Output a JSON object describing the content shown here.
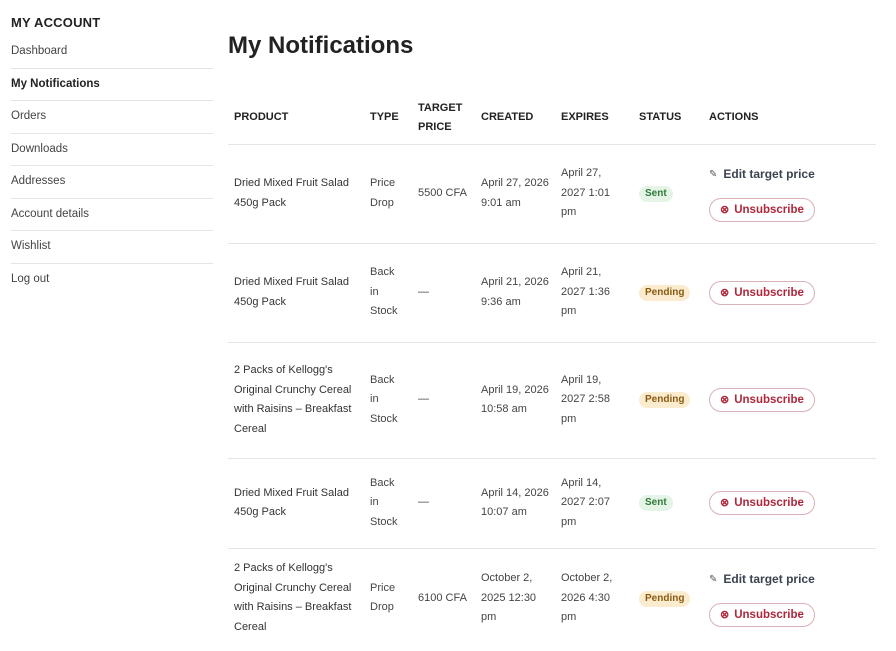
{
  "sidebar": {
    "title": "MY ACCOUNT",
    "items": [
      {
        "label": "Dashboard"
      },
      {
        "label": "My Notifications"
      },
      {
        "label": "Orders"
      },
      {
        "label": "Downloads"
      },
      {
        "label": "Addresses"
      },
      {
        "label": "Account details"
      },
      {
        "label": "Wishlist"
      },
      {
        "label": "Log out"
      }
    ]
  },
  "main": {
    "title": "My Notifications",
    "table": {
      "headers": {
        "product": "PRODUCT",
        "type": "TYPE",
        "target_price": "TARGET PRICE",
        "created": "CREATED",
        "expires": "EXPIRES",
        "status": "STATUS",
        "actions": "ACTIONS"
      },
      "edit_label": "Edit target price",
      "unsubscribe_label": "Unsubscribe",
      "rows": [
        {
          "product": "Dried Mixed Fruit Salad 450g Pack",
          "type": "Price Drop",
          "target_price": "5500 CFA",
          "created": "April 27, 2026 9:01 am",
          "expires": "April 27, 2027 1:01 pm",
          "status": "Sent"
        },
        {
          "product": "Dried Mixed Fruit Salad 450g Pack",
          "type": "Back in Stock",
          "target_price": "—",
          "created": "April 21, 2026 9:36 am",
          "expires": "April 21, 2027 1:36 pm",
          "status": "Pending"
        },
        {
          "product": "2 Packs of Kellogg's Original Crunchy Cereal with Raisins – Breakfast Cereal",
          "type": "Back in Stock",
          "target_price": "—",
          "created": "April 19, 2026 10:58 am",
          "expires": "April 19, 2027 2:58 pm",
          "status": "Pending"
        },
        {
          "product": "Dried Mixed Fruit Salad 450g Pack",
          "type": "Back in Stock",
          "target_price": "—",
          "created": "April 14, 2026 10:07 am",
          "expires": "April 14, 2027 2:07 pm",
          "status": "Sent"
        },
        {
          "product": "2 Packs of Kellogg's Original Crunchy Cereal with Raisins – Breakfast Cereal",
          "type": "Price Drop",
          "target_price": "6100 CFA",
          "created": "October 2, 2025 12:30 pm",
          "expires": "October 2, 2026 4:30 pm",
          "status": "Pending"
        }
      ]
    }
  },
  "colors": {
    "sent_bg": "#e4f4e6",
    "sent_text": "#2f7a3b",
    "pending_bg": "#fbecd0",
    "pending_text": "#8a5a10",
    "unsubscribe": "#b0273b"
  },
  "icons": {
    "edit": "pencil-icon",
    "unsubscribe": "circle-x-icon"
  }
}
